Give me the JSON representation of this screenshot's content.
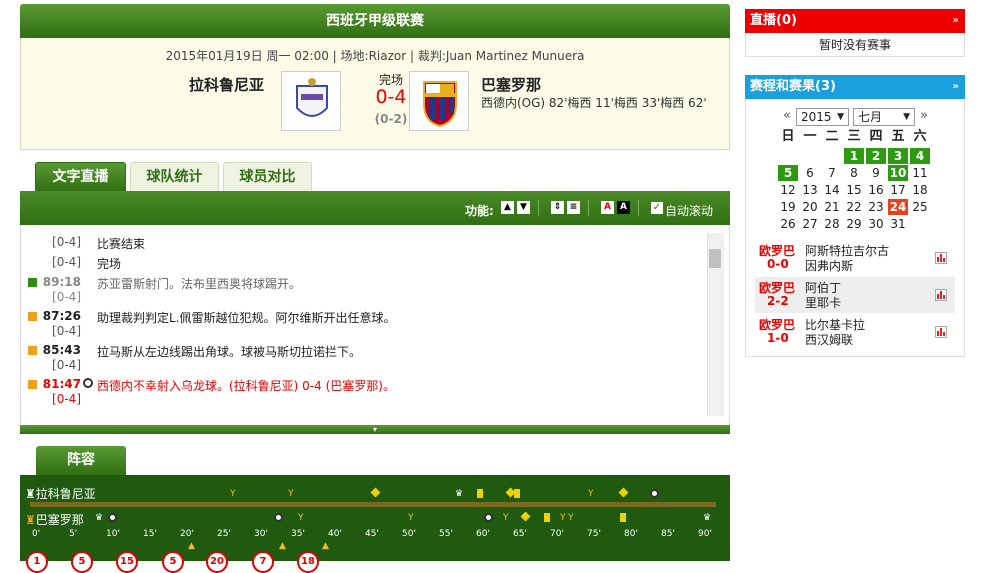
{
  "league": "西班牙甲级联赛",
  "match": {
    "meta": "2015年01月19日 周一 02:00 | 场地:Riazor | 裁判:Juan Martinez Munuera",
    "home": "拉科鲁尼亚",
    "away": "巴塞罗那",
    "status": "完场",
    "score": "0-4",
    "half": "(0-2)",
    "scorers": "西德内(OG) 82'梅西 11'梅西 33'梅西 62'"
  },
  "tabs": [
    "文字直播",
    "球队统计",
    "球员对比"
  ],
  "func": {
    "label": "功能:",
    "auto_scroll": "自动滚动"
  },
  "feed": [
    {
      "time": "",
      "score": "[0-4]",
      "text": "比赛结束",
      "color": "#222",
      "icon": ""
    },
    {
      "time": "",
      "score": "[0-4]",
      "text": "完场",
      "color": "#222",
      "icon": ""
    },
    {
      "time": "89:18",
      "score": "[0-4]",
      "text": "苏亚雷斯射门。法布里西奥将球踢开。",
      "color": "#666",
      "icon": "green"
    },
    {
      "time": "87:26",
      "score": "[0-4]",
      "text": "助理裁判判定L.佩雷斯越位犯规。阿尔维斯开出任意球。",
      "color": "#222",
      "icon": "orange"
    },
    {
      "time": "85:43",
      "score": "[0-4]",
      "text": "拉马斯从左边线踢出角球。球被马斯切拉诺拦下。",
      "color": "#222",
      "icon": "orange"
    },
    {
      "time": "81:47",
      "score": "[0-4]",
      "text": "西德内不幸射入乌龙球。(拉科鲁尼亚) 0-4 (巴塞罗那)。",
      "color": "#e00",
      "icon": "orange"
    }
  ],
  "lineup": {
    "tab": "阵容",
    "home": "拉科鲁尼亚",
    "away": "巴塞罗那",
    "ticks": [
      "0'",
      "5'",
      "10'",
      "15'",
      "20'",
      "25'",
      "30'",
      "35'",
      "40'",
      "45'",
      "50'",
      "55'",
      "60'",
      "65'",
      "70'",
      "75'",
      "80'",
      "85'",
      "90'"
    ],
    "subs": [
      "1",
      "5",
      "15",
      "5",
      "20",
      "7",
      "18"
    ]
  },
  "sidebar": {
    "live_title": "直播(0)",
    "live_empty": "暂时没有赛事",
    "cal_title": "赛程和赛果(3)",
    "year": "2015",
    "month": "七月",
    "weekdays": [
      "日",
      "一",
      "二",
      "三",
      "四",
      "五",
      "六"
    ],
    "days": [
      [
        "",
        "",
        "",
        "1",
        "2",
        "3",
        "4"
      ],
      [
        "5",
        "6",
        "7",
        "8",
        "9",
        "10",
        "11"
      ],
      [
        "12",
        "13",
        "14",
        "15",
        "16",
        "17",
        "18"
      ],
      [
        "19",
        "20",
        "21",
        "22",
        "23",
        "24",
        "25"
      ],
      [
        "26",
        "27",
        "28",
        "29",
        "30",
        "31",
        ""
      ]
    ],
    "matches": [
      {
        "comp": "欧罗巴",
        "score": "0-0",
        "t1": "阿斯特拉吉尔古",
        "t2": "因弗内斯"
      },
      {
        "comp": "欧罗巴",
        "score": "2-2",
        "t1": "阿伯丁",
        "t2": "里耶卡"
      },
      {
        "comp": "欧罗巴",
        "score": "1-0",
        "t1": "比尔基卡拉",
        "t2": "西汉姆联"
      }
    ]
  }
}
